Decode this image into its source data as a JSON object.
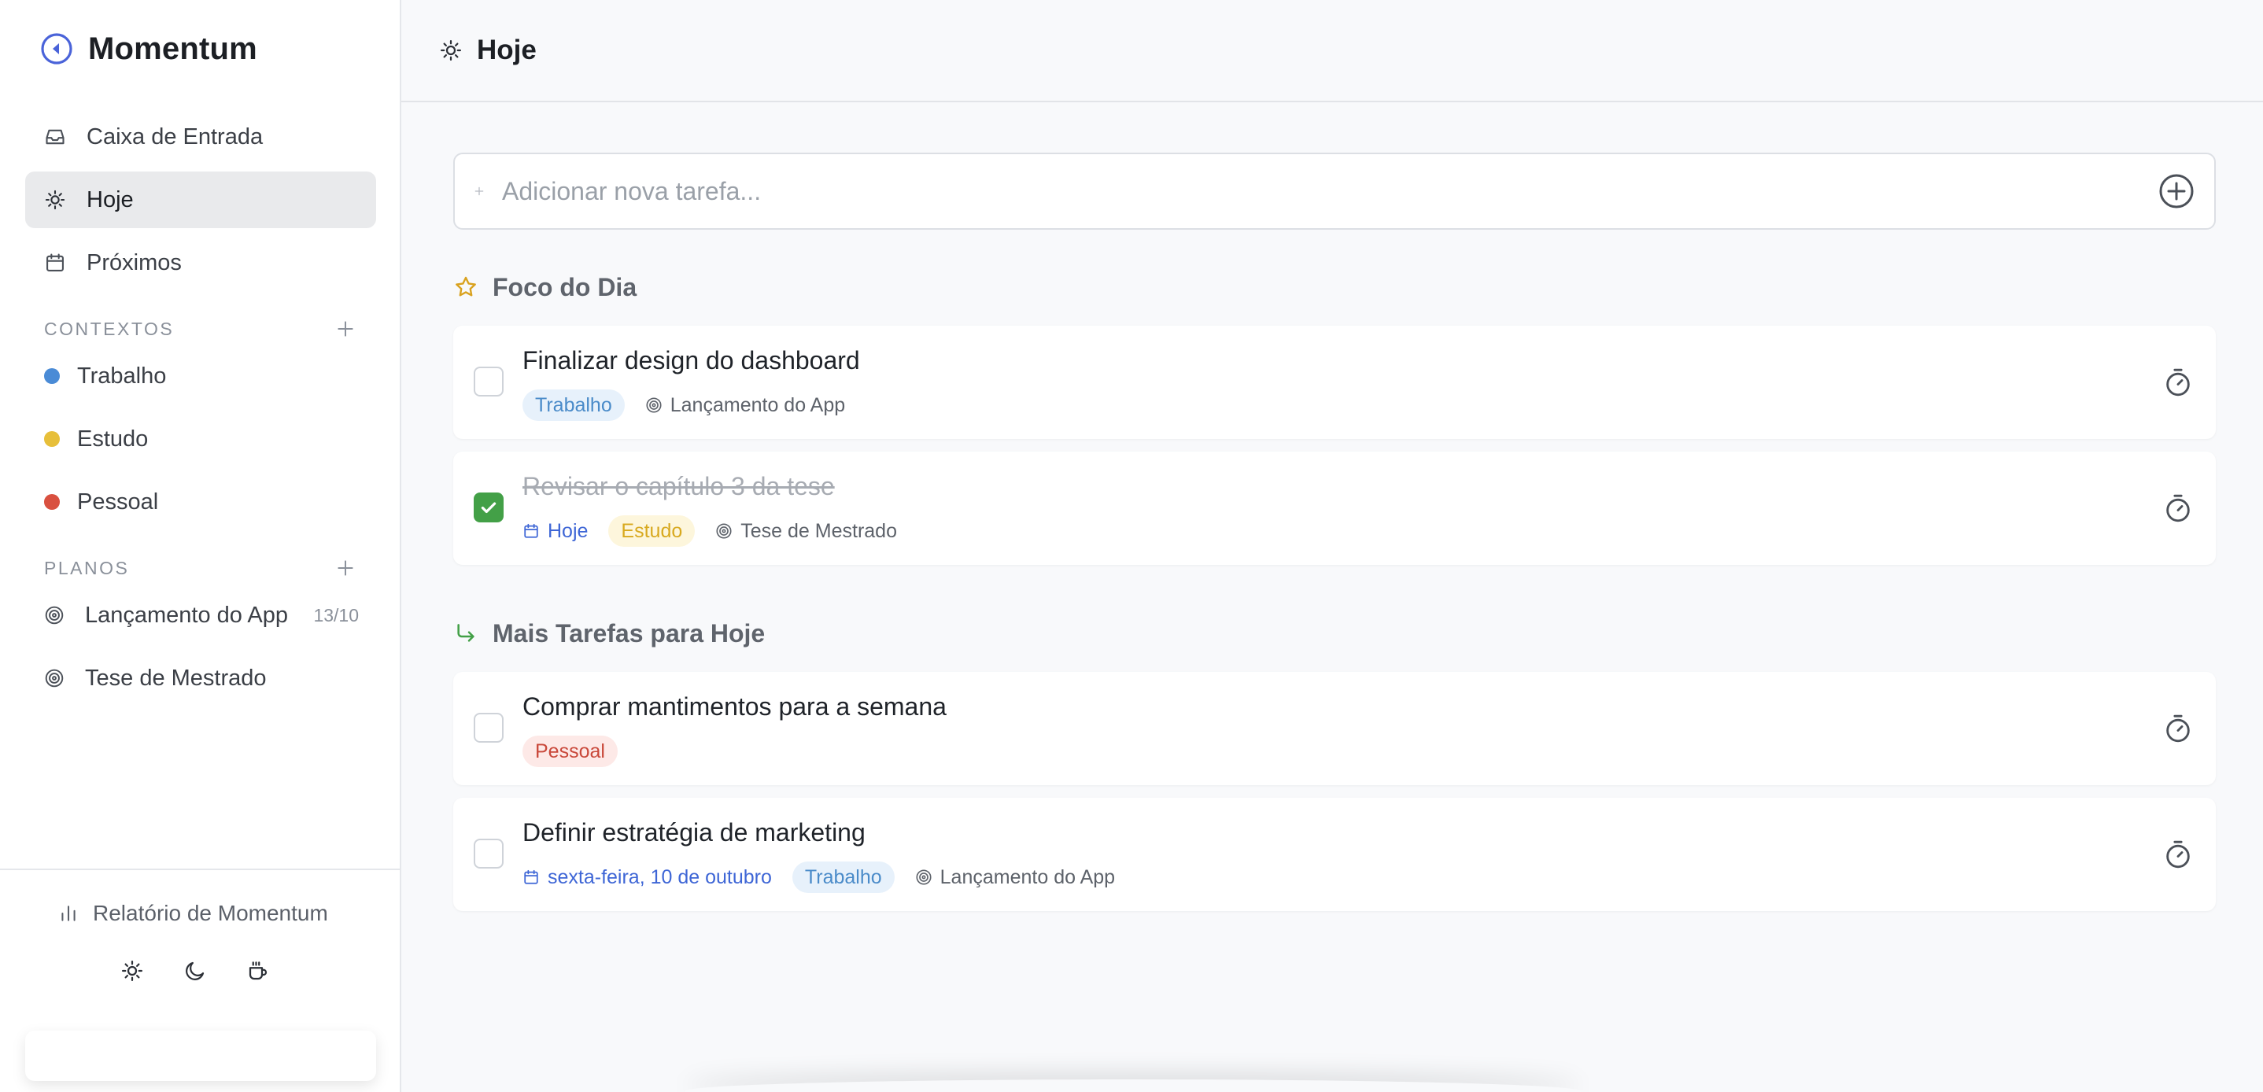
{
  "app": {
    "name": "Momentum",
    "accent": "#4a63d9"
  },
  "nav": {
    "items": [
      {
        "label": "Caixa de Entrada",
        "icon": "inbox-icon"
      },
      {
        "label": "Hoje",
        "icon": "sun-icon",
        "active": true
      },
      {
        "label": "Próximos",
        "icon": "calendar-icon"
      }
    ]
  },
  "contexts": {
    "heading": "CONTEXTOS",
    "items": [
      {
        "label": "Trabalho",
        "color": "#4a8bd6"
      },
      {
        "label": "Estudo",
        "color": "#e7bf3a"
      },
      {
        "label": "Pessoal",
        "color": "#d9503f"
      }
    ]
  },
  "plans": {
    "heading": "PLANOS",
    "items": [
      {
        "label": "Lançamento do App",
        "date": "13/10"
      },
      {
        "label": "Tese de Mestrado",
        "date": ""
      }
    ]
  },
  "footer": {
    "report_label": "Relatório de Momentum",
    "themes": [
      "sun-icon",
      "moon-icon",
      "coffee-icon"
    ]
  },
  "header": {
    "title": "Hoje"
  },
  "add_task": {
    "placeholder": "Adicionar nova tarefa..."
  },
  "groups": {
    "focus": {
      "title": "Foco do Dia",
      "tasks": [
        {
          "title": "Finalizar design do dashboard",
          "done": false,
          "tag": "Trabalho",
          "plan": "Lançamento do App"
        },
        {
          "title": "Revisar o capítulo 3 da tese",
          "done": true,
          "date": "Hoje",
          "tag": "Estudo",
          "plan": "Tese de Mestrado"
        }
      ]
    },
    "more": {
      "title": "Mais Tarefas para Hoje",
      "tasks": [
        {
          "title": "Comprar mantimentos para a semana",
          "done": false,
          "tag": "Pessoal"
        },
        {
          "title": "Definir estratégia de marketing",
          "done": false,
          "date": "sexta-feira, 10 de outubro",
          "tag": "Trabalho",
          "plan": "Lançamento do App"
        }
      ]
    }
  }
}
